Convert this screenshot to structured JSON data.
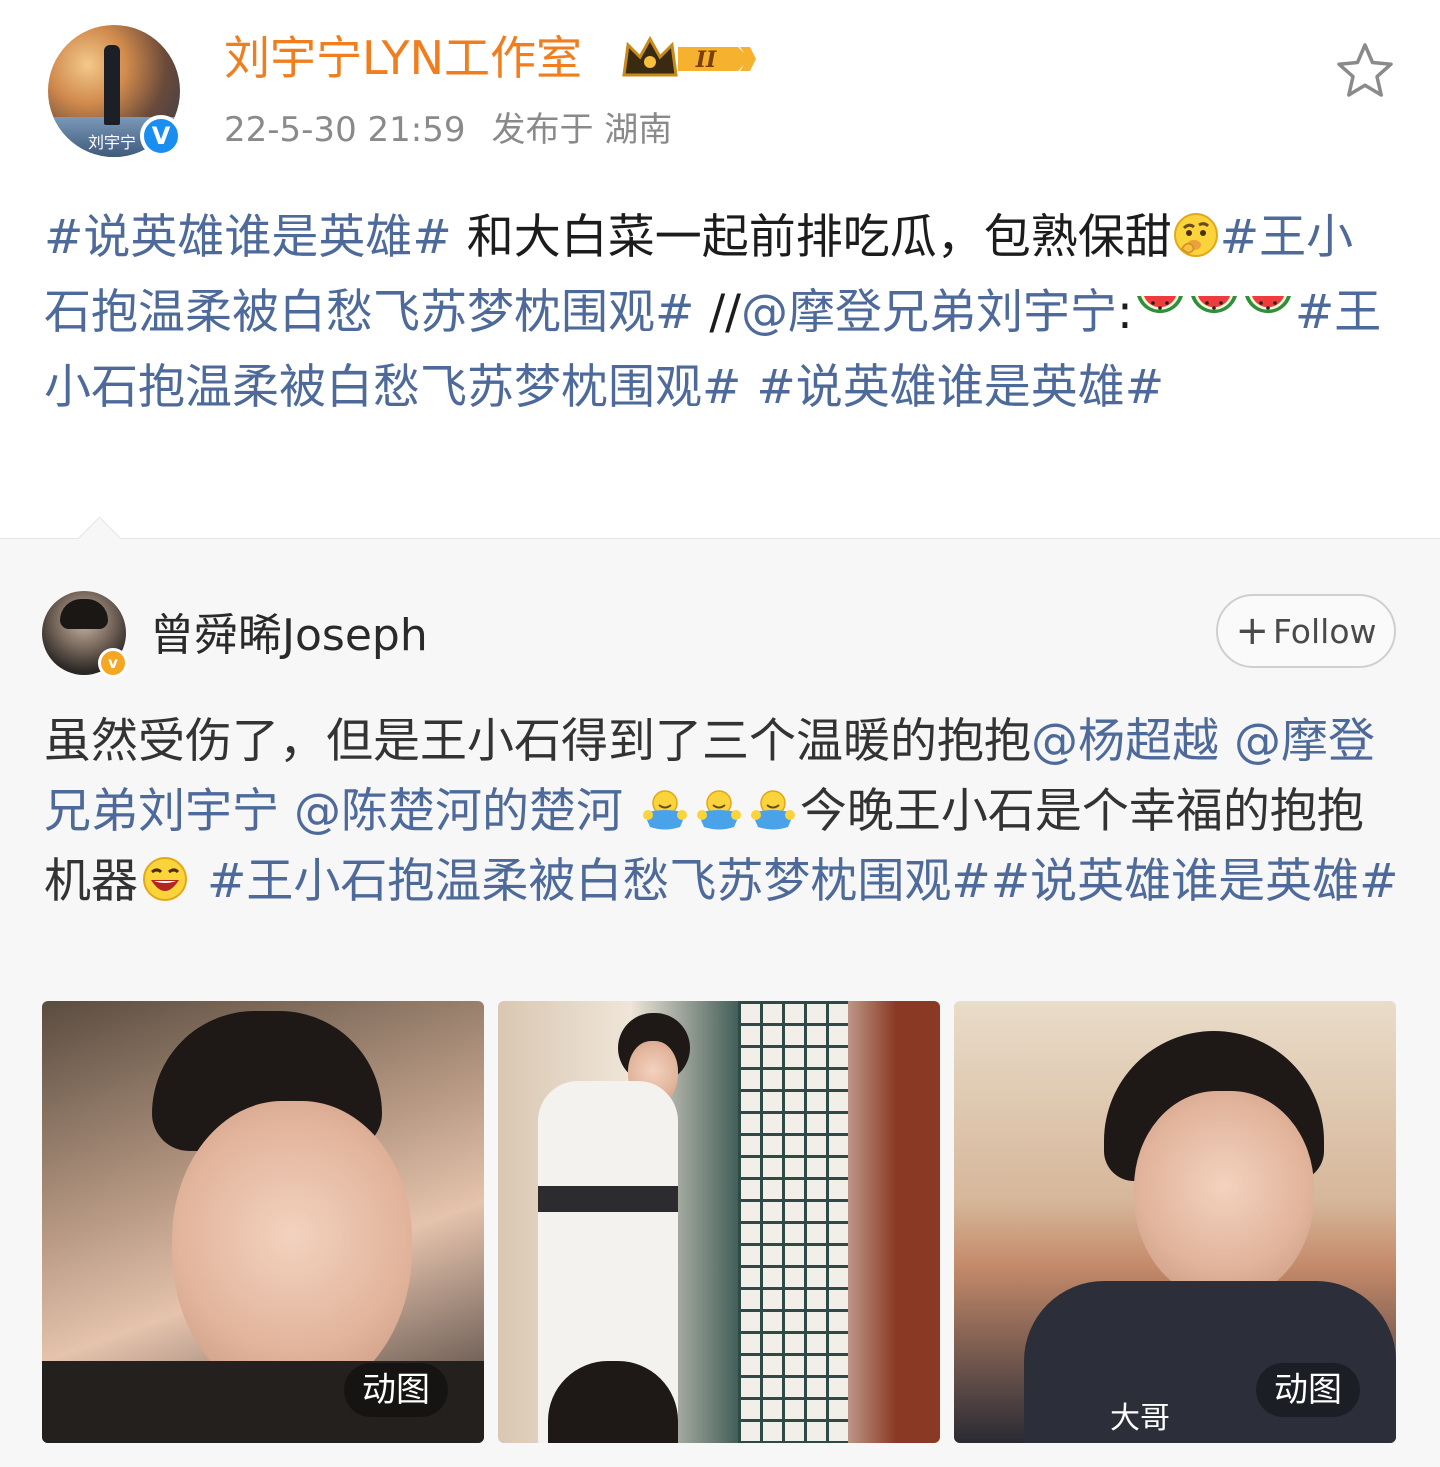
{
  "post": {
    "author": "刘宇宁LYN工作室",
    "level_badge": "II",
    "timestamp": "22-5-30 21:59",
    "location": "发布于 湖南",
    "avatar_signature": "刘宇宁",
    "verified_mark": "V",
    "text": {
      "t1": "#说英雄谁是英雄#",
      "t2": " 和大白菜一起前排吃瓜，包熟保甜",
      "t3": "#王小石抱温柔被白愁飞苏梦枕围观#",
      "t4": " //",
      "t5": "@摩登兄弟刘宇宁",
      "t6": ":",
      "t7": "#王小石抱温柔被白愁飞苏梦枕围观#",
      "t8": " ",
      "t9": "#说英雄谁是英雄#"
    },
    "emoji": [
      "thinking-emoji",
      "watermelon-emoji",
      "watermelon-emoji",
      "watermelon-emoji"
    ]
  },
  "retweet": {
    "author": "曾舜晞Joseph",
    "verified_mark": "v",
    "follow_label": "Follow",
    "follow_plus": "+",
    "text": {
      "r1": "虽然受伤了，但是王小石得到了三个温暖的抱抱",
      "r2": "@杨超越",
      "r3": " ",
      "r4": "@摩登兄弟刘宇宁",
      "r5": " ",
      "r6": "@陈楚河的楚河",
      "r7": " ",
      "r8": "今晚王小石是个幸福的抱抱机器",
      "r9": " ",
      "r10": "#王小石抱温柔被白愁飞苏梦枕围观#",
      "r11": "#说英雄谁是英雄#"
    },
    "emoji": [
      "hug-emoji",
      "hug-emoji",
      "hug-emoji",
      "laughing-emoji"
    ],
    "images": [
      {
        "badge": "动图",
        "caption": ""
      },
      {
        "badge": "",
        "caption": ""
      },
      {
        "badge": "动图",
        "caption": "大哥"
      }
    ]
  },
  "colors": {
    "author_name": "#f07e1e",
    "link": "#4d6a9a",
    "meta": "#8a8a8a",
    "verified_blue": "#1a8ef0",
    "verified_gold": "#f5a623",
    "retweet_bg": "#f7f7f7"
  }
}
